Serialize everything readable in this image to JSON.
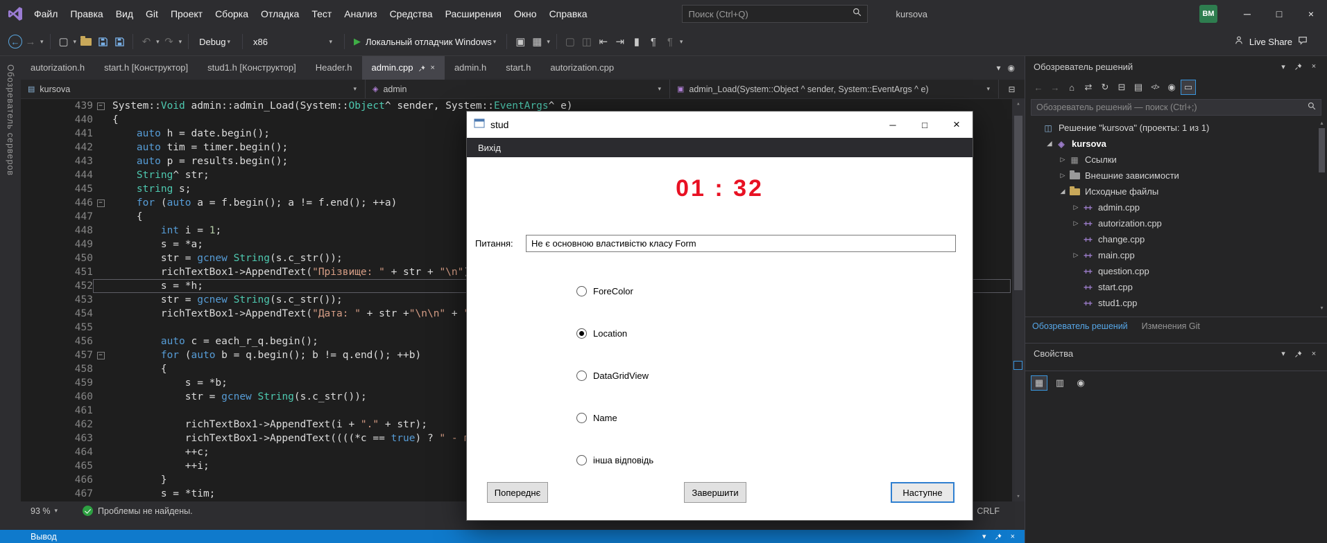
{
  "titlebar": {
    "menus": [
      "Файл",
      "Правка",
      "Вид",
      "Git",
      "Проект",
      "Сборка",
      "Отладка",
      "Тест",
      "Анализ",
      "Средства",
      "Расширения",
      "Окно",
      "Справка"
    ],
    "search_placeholder": "Поиск (Ctrl+Q)",
    "title": "kursova",
    "avatar_initials": "BM"
  },
  "toolbar": {
    "config_selector": "Debug",
    "platform_selector": "x86",
    "run_button": "Локальный отладчик Windows",
    "live_share": "Live Share"
  },
  "left_strip": {
    "vertical_tab": "Обозреватель серверов"
  },
  "tabs": [
    {
      "label": "autorization.h",
      "active": false
    },
    {
      "label": "start.h [Конструктор]",
      "active": false
    },
    {
      "label": "stud1.h [Конструктор]",
      "active": false
    },
    {
      "label": "Header.h",
      "active": false
    },
    {
      "label": "admin.cpp",
      "active": true
    },
    {
      "label": "admin.h",
      "active": false
    },
    {
      "label": "start.h",
      "active": false
    },
    {
      "label": "autorization.cpp",
      "active": false
    }
  ],
  "breadcrumb": {
    "project": "kursova",
    "type": "admin",
    "member": "admin_Load(System::Object ^ sender, System::EventArgs ^ e)"
  },
  "editor": {
    "zoom": "93 %",
    "problems": "Проблемы не найдены.",
    "line_ending": "CRLF",
    "lines": [
      {
        "n": 439,
        "fold": true,
        "t": [
          [
            "System::",
            "p"
          ],
          [
            "Void",
            "t"
          ],
          [
            " admin::admin_Load(",
            "p"
          ],
          [
            "System::",
            "p"
          ],
          [
            "Object",
            "t"
          ],
          [
            "^ sender, ",
            "p"
          ],
          [
            "System::",
            "p"
          ],
          [
            "EventArgs",
            "t"
          ],
          [
            "^ e)",
            "p"
          ]
        ]
      },
      {
        "n": 440,
        "t": [
          [
            "{",
            "p"
          ]
        ]
      },
      {
        "n": 441,
        "t": [
          [
            "    ",
            "p"
          ],
          [
            "auto",
            "k"
          ],
          [
            " h = date.begin();",
            "p"
          ]
        ]
      },
      {
        "n": 442,
        "t": [
          [
            "    ",
            "p"
          ],
          [
            "auto",
            "k"
          ],
          [
            " tim = timer.begin();",
            "p"
          ]
        ]
      },
      {
        "n": 443,
        "t": [
          [
            "    ",
            "p"
          ],
          [
            "auto",
            "k"
          ],
          [
            " p = results.begin();",
            "p"
          ]
        ]
      },
      {
        "n": 444,
        "t": [
          [
            "    ",
            "p"
          ],
          [
            "String",
            "t"
          ],
          [
            "^ str;",
            "p"
          ]
        ]
      },
      {
        "n": 445,
        "t": [
          [
            "    ",
            "p"
          ],
          [
            "string",
            "t"
          ],
          [
            " s;",
            "p"
          ]
        ]
      },
      {
        "n": 446,
        "fold": true,
        "t": [
          [
            "    ",
            "p"
          ],
          [
            "for",
            "k"
          ],
          [
            " (",
            "p"
          ],
          [
            "auto",
            "k"
          ],
          [
            " a = f.begin(); a != f.end(); ++a)",
            "p"
          ]
        ]
      },
      {
        "n": 447,
        "t": [
          [
            "    {",
            "p"
          ]
        ]
      },
      {
        "n": 448,
        "t": [
          [
            "        ",
            "p"
          ],
          [
            "int",
            "k"
          ],
          [
            " i = ",
            "p"
          ],
          [
            "1",
            "n"
          ],
          [
            ";",
            "p"
          ]
        ]
      },
      {
        "n": 449,
        "t": [
          [
            "        s = *a;",
            "p"
          ]
        ]
      },
      {
        "n": 450,
        "t": [
          [
            "        str = ",
            "p"
          ],
          [
            "gcnew",
            "k"
          ],
          [
            " ",
            "p"
          ],
          [
            "String",
            "t"
          ],
          [
            "(s.c_str());",
            "p"
          ]
        ]
      },
      {
        "n": 451,
        "t": [
          [
            "        richTextBox1->AppendText(",
            "p"
          ],
          [
            "\"Прізвище: \"",
            "s"
          ],
          [
            " + str + ",
            "p"
          ],
          [
            "\"\\n\"",
            "s"
          ],
          [
            ");",
            "p"
          ]
        ]
      },
      {
        "n": 452,
        "hl": true,
        "t": [
          [
            "        s = *h;",
            "p"
          ]
        ]
      },
      {
        "n": 453,
        "t": [
          [
            "        str = ",
            "p"
          ],
          [
            "gcnew",
            "k"
          ],
          [
            " ",
            "p"
          ],
          [
            "String",
            "t"
          ],
          [
            "(s.c_str());",
            "p"
          ]
        ]
      },
      {
        "n": 454,
        "t": [
          [
            "        richTextBox1->AppendText(",
            "p"
          ],
          [
            "\"Дата: \"",
            "s"
          ],
          [
            " + str +",
            "p"
          ],
          [
            "\"\\n\\n\"",
            "s"
          ],
          [
            " + ",
            "p"
          ],
          [
            "\"Отве",
            "s"
          ]
        ]
      },
      {
        "n": 455,
        "t": []
      },
      {
        "n": 456,
        "t": [
          [
            "        ",
            "p"
          ],
          [
            "auto",
            "k"
          ],
          [
            " c = each_r_q.begin();",
            "p"
          ]
        ]
      },
      {
        "n": 457,
        "fold": true,
        "t": [
          [
            "        ",
            "p"
          ],
          [
            "for",
            "k"
          ],
          [
            " (",
            "p"
          ],
          [
            "auto",
            "k"
          ],
          [
            " b = q.begin(); b != q.end(); ++b)",
            "p"
          ]
        ]
      },
      {
        "n": 458,
        "t": [
          [
            "        {",
            "p"
          ]
        ]
      },
      {
        "n": 459,
        "t": [
          [
            "            s = *b;",
            "p"
          ]
        ]
      },
      {
        "n": 460,
        "t": [
          [
            "            str = ",
            "p"
          ],
          [
            "gcnew",
            "k"
          ],
          [
            " ",
            "p"
          ],
          [
            "String",
            "t"
          ],
          [
            "(s.c_str());",
            "p"
          ]
        ]
      },
      {
        "n": 461,
        "t": []
      },
      {
        "n": 462,
        "t": [
          [
            "            richTextBox1->AppendText(i + ",
            "p"
          ],
          [
            "\".\"",
            "s"
          ],
          [
            " + str);",
            "p"
          ]
        ]
      },
      {
        "n": 463,
        "t": [
          [
            "            richTextBox1->AppendText((((*c == ",
            "p"
          ],
          [
            "true",
            "k"
          ],
          [
            ") ? ",
            "p"
          ],
          [
            "\" - правил",
            "s"
          ]
        ]
      },
      {
        "n": 464,
        "t": [
          [
            "            ++c;",
            "p"
          ]
        ]
      },
      {
        "n": 465,
        "t": [
          [
            "            ++i;",
            "p"
          ]
        ]
      },
      {
        "n": 466,
        "t": [
          [
            "        }",
            "p"
          ]
        ]
      },
      {
        "n": 467,
        "t": [
          [
            "        s = *tim;",
            "p"
          ]
        ]
      }
    ]
  },
  "stud_window": {
    "title": "stud",
    "menu": "Вихід",
    "timer": "01 : 32",
    "question_label": "Питання:",
    "question_text": "Не є основною властивістю класу Form",
    "options": [
      {
        "label": "ForeColor",
        "selected": false
      },
      {
        "label": "Location",
        "selected": true
      },
      {
        "label": "DataGridView",
        "selected": false
      },
      {
        "label": "Name",
        "selected": false
      },
      {
        "label": "інша відповідь",
        "selected": false
      }
    ],
    "buttons": {
      "prev": "Попереднє",
      "finish": "Завершити",
      "next": "Наступне"
    }
  },
  "solution_explorer": {
    "title": "Обозреватель решений",
    "search_placeholder": "Обозреватель решений — поиск (Ctrl+;)",
    "tree": [
      {
        "label": "Решение \"kursova\" (проекты: 1 из 1)",
        "indent": 0,
        "icon": "solution",
        "expander": "none"
      },
      {
        "label": "kursova",
        "indent": 1,
        "icon": "project",
        "expander": "expanded",
        "bold": true
      },
      {
        "label": "Ссылки",
        "indent": 2,
        "icon": "references",
        "expander": "collapsed"
      },
      {
        "label": "Внешние зависимости",
        "indent": 2,
        "icon": "deps",
        "expander": "collapsed"
      },
      {
        "label": "Исходные файлы",
        "indent": 2,
        "icon": "folder",
        "expander": "expanded"
      },
      {
        "label": "admin.cpp",
        "indent": 3,
        "icon": "cpp",
        "expander": "collapsed"
      },
      {
        "label": "autorization.cpp",
        "indent": 3,
        "icon": "cpp",
        "expander": "collapsed"
      },
      {
        "label": "change.cpp",
        "indent": 3,
        "icon": "cpp",
        "expander": "none"
      },
      {
        "label": "main.cpp",
        "indent": 3,
        "icon": "cpp",
        "expander": "collapsed"
      },
      {
        "label": "question.cpp",
        "indent": 3,
        "icon": "cpp",
        "expander": "none"
      },
      {
        "label": "start.cpp",
        "indent": 3,
        "icon": "cpp",
        "expander": "none"
      },
      {
        "label": "stud1.cpp",
        "indent": 3,
        "icon": "cpp",
        "expander": "none"
      }
    ],
    "bottom_tabs": [
      {
        "label": "Обозреватель решений",
        "active": true
      },
      {
        "label": "Изменения Git",
        "active": false
      }
    ]
  },
  "properties_panel": {
    "title": "Свойства"
  },
  "output_bar": {
    "title": "Вывод"
  },
  "colors": {
    "accent_blue": "#0f7acc",
    "run_green": "#3fae46",
    "timer_red": "#e81123",
    "avatar_green": "#2e7d4f"
  },
  "icons": {
    "minimize": "─",
    "maximize": "□",
    "close": "×",
    "dropdown": "▾",
    "scroll_up": "▴",
    "scroll_down": "▾",
    "fold": "−",
    "back": "←",
    "forward": "→",
    "undo": "↶",
    "redo": "↷",
    "run": "▶",
    "new_file": "▢",
    "attach": "▣",
    "picture": "▦",
    "columns": "◫",
    "outdent": "⇤",
    "indent": "⇥",
    "bookmark": "▮",
    "comment": "¶",
    "home": "⌂",
    "sync": "⇄",
    "collapse_all": "⊟",
    "show_all": "▤",
    "refresh": "↻",
    "code_view": "</>",
    "props": "◉",
    "preview": "▭",
    "split": "⊟",
    "tab_list": "▾",
    "tab_options": "◉",
    "solution": "◫",
    "project": "◈",
    "references": "▦",
    "cpp": "++",
    "expander_open": "◢",
    "expander_closed": "▷",
    "breadcrumb_file": "▤",
    "breadcrumb_class": "◈",
    "breadcrumb_method": "▣",
    "prop_categorized": "▦",
    "prop_events": "▥",
    "prop_settings": "◉"
  }
}
